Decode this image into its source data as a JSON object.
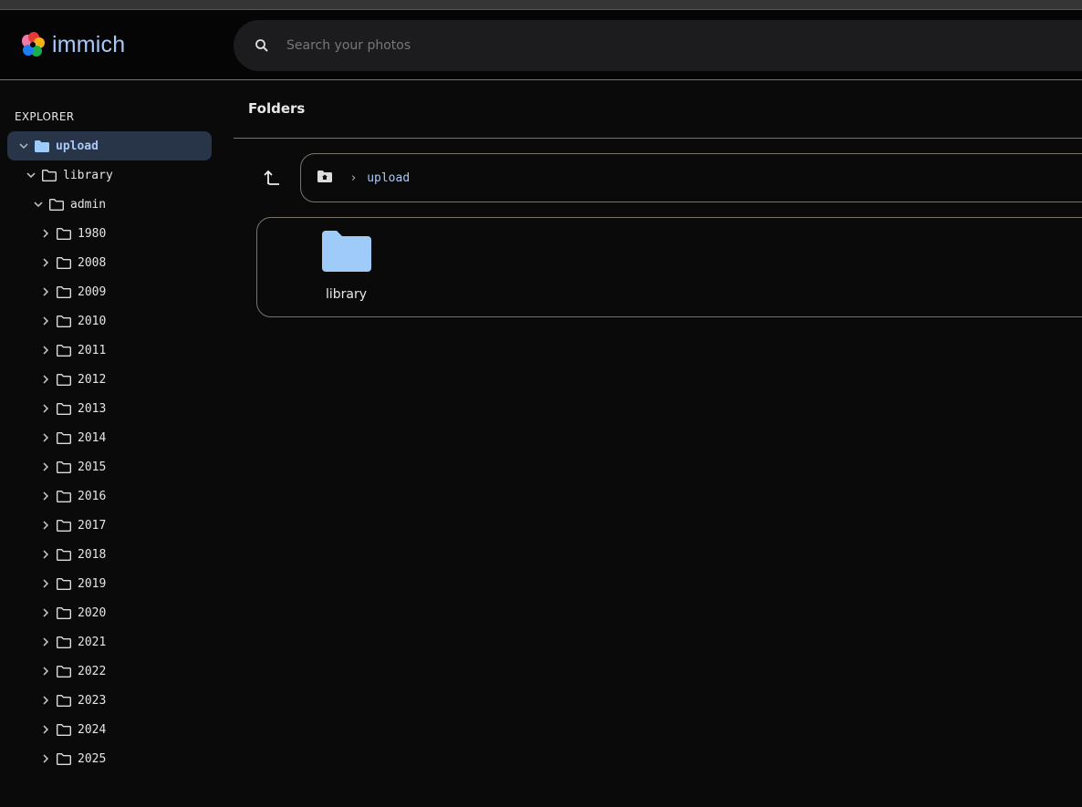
{
  "app": {
    "name": "immich"
  },
  "search": {
    "placeholder": "Search your photos"
  },
  "sidebar": {
    "heading": "EXPLORER",
    "root": "upload",
    "library": "library",
    "admin": "admin",
    "years": [
      "1980",
      "2008",
      "2009",
      "2010",
      "2011",
      "2012",
      "2013",
      "2014",
      "2015",
      "2016",
      "2017",
      "2018",
      "2019",
      "2020",
      "2021",
      "2022",
      "2023",
      "2024",
      "2025"
    ]
  },
  "main": {
    "title": "Folders",
    "breadcrumb": {
      "current": "upload"
    },
    "folders": [
      {
        "name": "library"
      }
    ]
  },
  "colors": {
    "accent": "#a8c8f8",
    "selected_bg": "#283447",
    "folder": "#9ecbfa"
  }
}
